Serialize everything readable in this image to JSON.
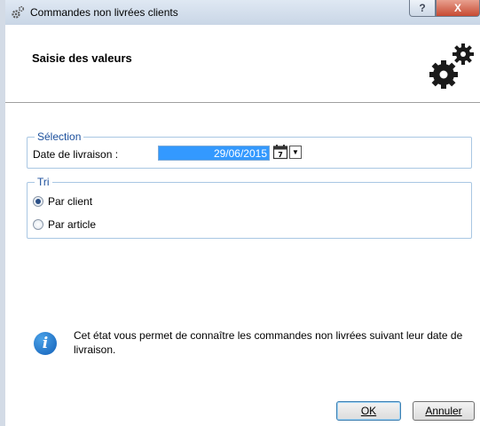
{
  "window": {
    "title": "Commandes non livrées clients",
    "help_label": "?",
    "close_label": "X"
  },
  "header": {
    "title": "Saisie des valeurs"
  },
  "selection": {
    "legend": "Sélection",
    "date_label": "Date de livraison :",
    "date_value": "29/06/2015",
    "calendar_day": "7"
  },
  "tri": {
    "legend": "Tri",
    "options": [
      {
        "label": "Par client",
        "checked": true
      },
      {
        "label": "Par article",
        "checked": false
      }
    ]
  },
  "info": {
    "text": "Cet état vous permet de connaître les commandes non livrées suivant leur date de livraison."
  },
  "buttons": {
    "ok": "OK",
    "cancel": "Annuler"
  },
  "colors": {
    "accent": "#3399ff",
    "legend": "#1b4f9c"
  }
}
